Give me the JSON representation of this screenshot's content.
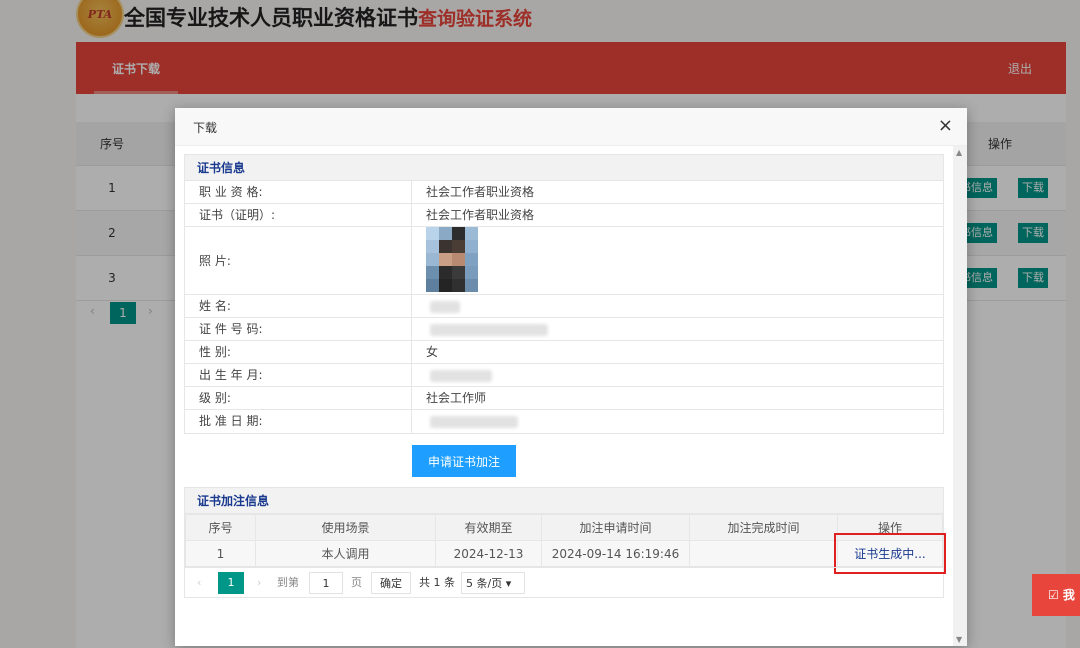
{
  "header": {
    "logo_text": "PTA",
    "title": "全国专业技术人员职业资格证书",
    "subtitle": "查询验证系统",
    "top_right": "…"
  },
  "nav": {
    "tab": "证书下载",
    "logout": "退出"
  },
  "background_table": {
    "col_no": "序号",
    "col_op": "操作",
    "rows": [
      "1",
      "2",
      "3"
    ],
    "info_btn": "书信息",
    "download_btn": "下载",
    "page": "1"
  },
  "modal": {
    "title": "下载",
    "close": "×",
    "cert_section_title": "证书信息",
    "fields": [
      {
        "label": "职 业 资 格:",
        "value": "社会工作者职业资格"
      },
      {
        "label": "证书（证明）:",
        "value": "社会工作者职业资格"
      },
      {
        "label": "照          片:",
        "value": ""
      },
      {
        "label": "姓          名:",
        "value": ""
      },
      {
        "label": "证 件 号 码:",
        "value": ""
      },
      {
        "label": "性          别:",
        "value": "女"
      },
      {
        "label": "出 生 年 月:",
        "value": ""
      },
      {
        "label": "级          别:",
        "value": "社会工作师"
      },
      {
        "label": "批 准 日 期:",
        "value": ""
      }
    ],
    "apply_button": "申请证书加注",
    "annotation_title": "证书加注信息",
    "annotation_headers": [
      "序号",
      "使用场景",
      "有效期至",
      "加注申请时间",
      "加注完成时间",
      "操作"
    ],
    "annotation_rows": [
      {
        "no": "1",
        "scene": "本人调用",
        "valid_until": "2024-12-13",
        "apply_time": "2024-09-14 16:19:46",
        "done_time": "",
        "op": "证书生成中..."
      }
    ],
    "pager": {
      "current": "1",
      "goto_label": "到第",
      "goto_value": "1",
      "page_unit": "页",
      "ok": "确定",
      "total": "共 1 条",
      "page_size": "5 条/页"
    }
  },
  "side_tab": "☑ 我",
  "colors": {
    "brand_red": "#e8453c",
    "primary_blue": "#1e9fff",
    "teal": "#009688",
    "highlight_box": "#e02020"
  }
}
